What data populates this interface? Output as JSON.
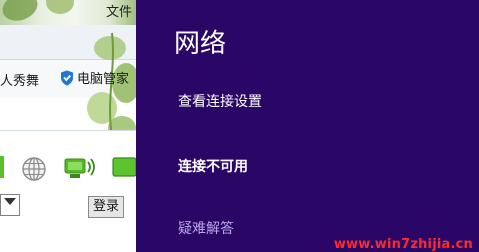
{
  "colors": {
    "panel_bg": "#2a0767",
    "panel_text": "#ffffff",
    "troubleshoot_text": "#b9a8e6",
    "watermark": "#ff2a2a"
  },
  "background": {
    "file_menu_label": "文件",
    "favorites": [
      {
        "label": "人秀舞",
        "icon": null
      },
      {
        "label": "电脑管家",
        "icon": "shield-icon"
      }
    ],
    "toolbar_icons": [
      "globe-icon",
      "network-signal-icon",
      "battery-icon"
    ],
    "login_button_label": "登录"
  },
  "panel": {
    "title": "网络",
    "view_connection_settings": "查看连接设置",
    "status": "连接不可用",
    "troubleshoot": "疑难解答"
  },
  "watermark": "www.win7zhijia.cn"
}
